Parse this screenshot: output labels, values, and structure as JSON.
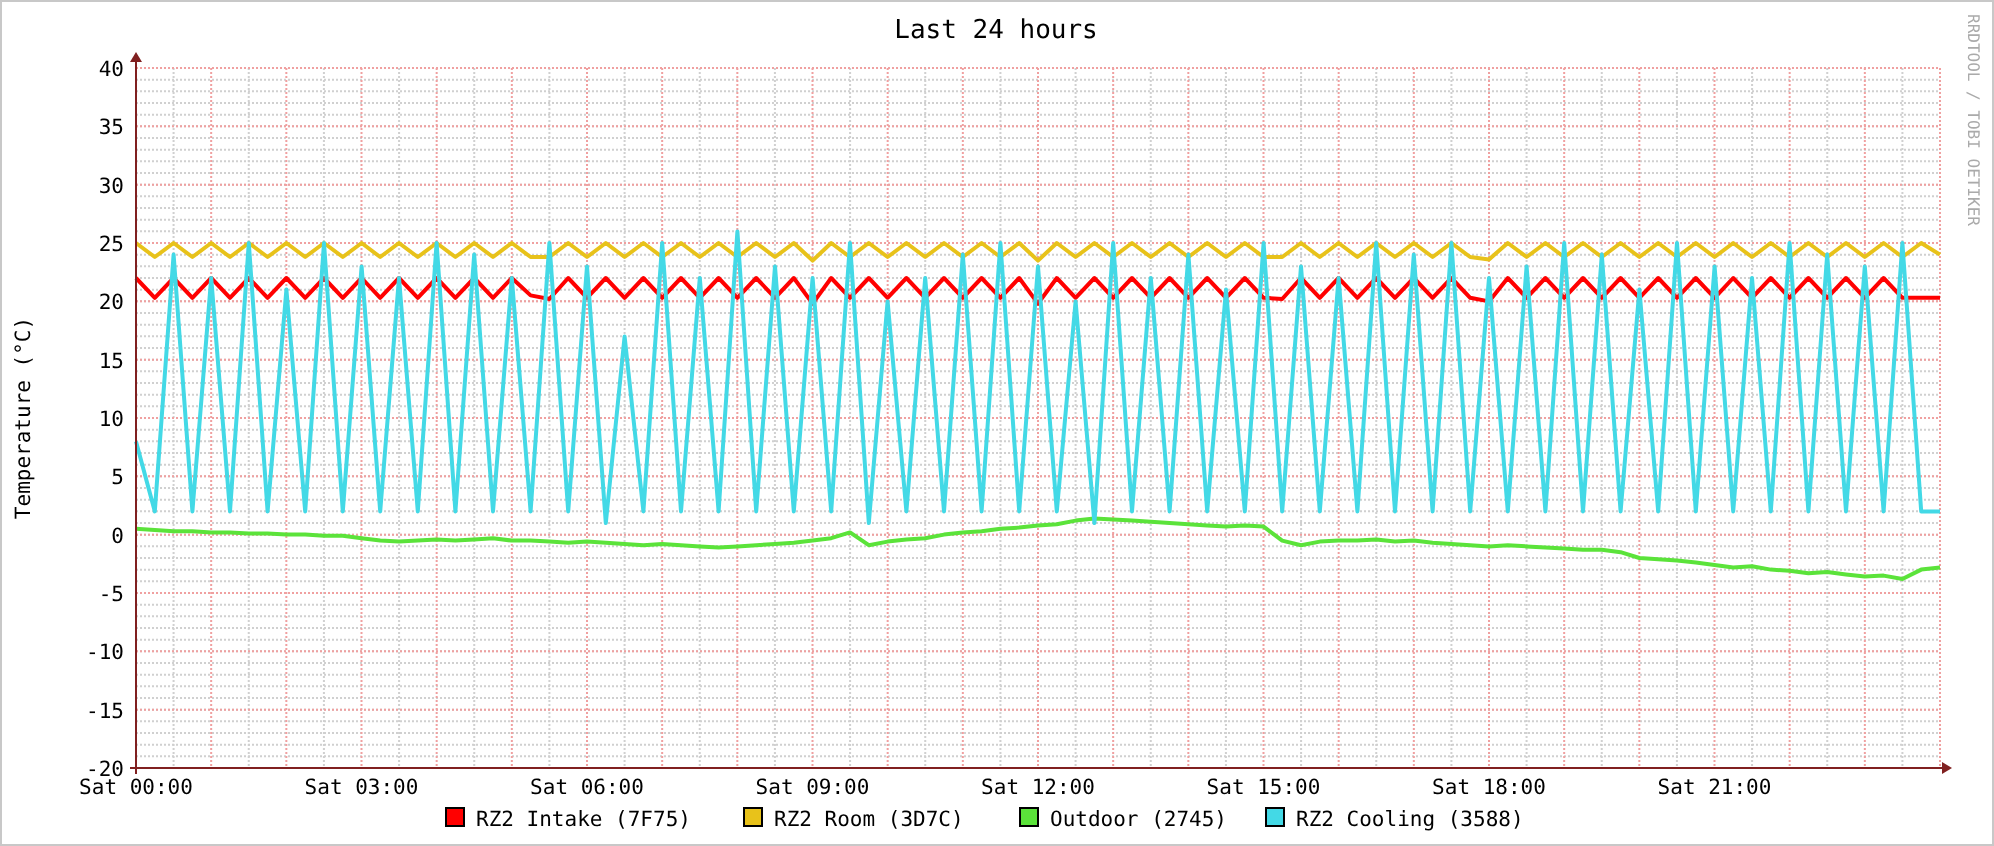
{
  "graph": {
    "credit": "RRDTOOL / TOBI OETIKER",
    "chart_data": {
      "type": "line",
      "title": "Last 24 hours",
      "ylabel": "Temperature (°C)",
      "grid": true,
      "legend": "bottom",
      "ylim": [
        -20,
        40
      ],
      "yticks": [
        -20,
        -15,
        -10,
        -5,
        0,
        5,
        10,
        15,
        20,
        25,
        30,
        35,
        40
      ],
      "categories": [
        "Sat 00:00",
        null,
        null,
        null,
        null,
        null,
        null,
        null,
        null,
        null,
        null,
        null,
        "Sat 03:00",
        null,
        null,
        null,
        null,
        null,
        null,
        null,
        null,
        null,
        null,
        null,
        "Sat 06:00",
        null,
        null,
        null,
        null,
        null,
        null,
        null,
        null,
        null,
        null,
        null,
        "Sat 09:00",
        null,
        null,
        null,
        null,
        null,
        null,
        null,
        null,
        null,
        null,
        null,
        "Sat 12:00",
        null,
        null,
        null,
        null,
        null,
        null,
        null,
        null,
        null,
        null,
        null,
        "Sat 15:00",
        null,
        null,
        null,
        null,
        null,
        null,
        null,
        null,
        null,
        null,
        null,
        "Sat 18:00",
        null,
        null,
        null,
        null,
        null,
        null,
        null,
        null,
        null,
        null,
        null,
        "Sat 21:00",
        null,
        null,
        null,
        null,
        null,
        null,
        null,
        null,
        null,
        null,
        null,
        null
      ],
      "series": [
        {
          "name": "RZ2 Intake (7F75)",
          "color": "#ff0000",
          "values": [
            22,
            20.3,
            22,
            20.3,
            22,
            20.3,
            22,
            20.3,
            22,
            20.3,
            22,
            20.3,
            22,
            20.3,
            22,
            20.3,
            22,
            20.3,
            22,
            20.3,
            22,
            20.5,
            20.2,
            22,
            20.3,
            22,
            20.3,
            22,
            20.3,
            22,
            20.3,
            22,
            20.3,
            22,
            20.3,
            22,
            19.8,
            22,
            20.3,
            22,
            20.3,
            22,
            20.3,
            22,
            20.3,
            22,
            20.3,
            22,
            19.8,
            22,
            20.3,
            22,
            20.3,
            22,
            20.3,
            22,
            20.3,
            22,
            20.3,
            22,
            20.3,
            20.2,
            22,
            20.3,
            22,
            20.3,
            22,
            20.3,
            22,
            20.3,
            22,
            20.3,
            20,
            22,
            20.3,
            22,
            20.3,
            22,
            20.3,
            22,
            20.3,
            22,
            20.3,
            22,
            20.3,
            22,
            20.3,
            22,
            20.3,
            22,
            20.3,
            22,
            20.3,
            22,
            20.3,
            20.3,
            20.3
          ]
        },
        {
          "name": "RZ2 Room (3D7C)",
          "color": "#e8c21a",
          "values": [
            25,
            23.8,
            25,
            23.8,
            25,
            23.8,
            25,
            23.8,
            25,
            23.8,
            25,
            23.8,
            25,
            23.8,
            25,
            23.8,
            25,
            23.8,
            25,
            23.8,
            25,
            23.8,
            23.8,
            25,
            23.8,
            25,
            23.8,
            25,
            23.8,
            25,
            23.8,
            25,
            23.8,
            25,
            23.8,
            25,
            23.5,
            25,
            23.8,
            25,
            23.8,
            25,
            23.8,
            25,
            23.8,
            25,
            23.8,
            25,
            23.5,
            25,
            23.8,
            25,
            23.8,
            25,
            23.8,
            25,
            23.8,
            25,
            23.8,
            25,
            23.8,
            23.8,
            25,
            23.8,
            25,
            23.8,
            25,
            23.8,
            25,
            23.8,
            25,
            23.8,
            23.6,
            25,
            23.8,
            25,
            23.8,
            25,
            23.8,
            25,
            23.8,
            25,
            23.8,
            25,
            23.8,
            25,
            23.8,
            25,
            23.8,
            25,
            23.8,
            25,
            23.8,
            25,
            23.8,
            25,
            24
          ]
        },
        {
          "name": "Outdoor (2745)",
          "color": "#5be33a",
          "values": [
            0.5,
            0.4,
            0.3,
            0.3,
            0.2,
            0.2,
            0.1,
            0.1,
            0.0,
            0.0,
            -0.1,
            -0.1,
            -0.3,
            -0.5,
            -0.6,
            -0.5,
            -0.4,
            -0.5,
            -0.4,
            -0.3,
            -0.5,
            -0.5,
            -0.6,
            -0.7,
            -0.6,
            -0.7,
            -0.8,
            -0.9,
            -0.8,
            -0.9,
            -1.0,
            -1.1,
            -1.0,
            -0.9,
            -0.8,
            -0.7,
            -0.5,
            -0.3,
            0.2,
            -0.9,
            -0.6,
            -0.4,
            -0.3,
            0.0,
            0.2,
            0.3,
            0.5,
            0.6,
            0.8,
            0.9,
            1.2,
            1.4,
            1.3,
            1.2,
            1.1,
            1.0,
            0.9,
            0.8,
            0.7,
            0.8,
            0.7,
            -0.5,
            -0.9,
            -0.6,
            -0.5,
            -0.5,
            -0.4,
            -0.6,
            -0.5,
            -0.7,
            -0.8,
            -0.9,
            -1.0,
            -0.9,
            -1.0,
            -1.1,
            -1.2,
            -1.3,
            -1.3,
            -1.5,
            -2.0,
            -2.1,
            -2.2,
            -2.4,
            -2.6,
            -2.8,
            -2.7,
            -3.0,
            -3.1,
            -3.3,
            -3.2,
            -3.4,
            -3.6,
            -3.5,
            -3.8,
            -3.0,
            -2.8
          ]
        },
        {
          "name": "RZ2 Cooling (3588)",
          "color": "#43d9e6",
          "values": [
            8,
            2,
            24,
            2,
            22,
            2,
            25,
            2,
            21,
            2,
            25,
            2,
            23,
            2,
            22,
            2,
            25,
            2,
            24,
            2,
            22,
            2,
            25,
            2,
            23,
            1,
            17,
            2,
            25,
            2,
            22,
            2,
            26,
            2,
            23,
            2,
            22,
            2,
            25,
            1,
            20,
            2,
            22,
            2,
            24,
            2,
            25,
            2,
            23,
            2,
            20,
            1,
            25,
            2,
            22,
            2,
            24,
            2,
            21,
            2,
            25,
            2,
            23,
            2,
            22,
            2,
            25,
            2,
            24,
            2,
            25,
            2,
            22,
            2,
            23,
            2,
            25,
            2,
            24,
            2,
            21,
            2,
            25,
            2,
            23,
            2,
            22,
            2,
            25,
            2,
            24,
            2,
            23,
            2,
            25,
            2,
            2
          ]
        }
      ]
    }
  }
}
